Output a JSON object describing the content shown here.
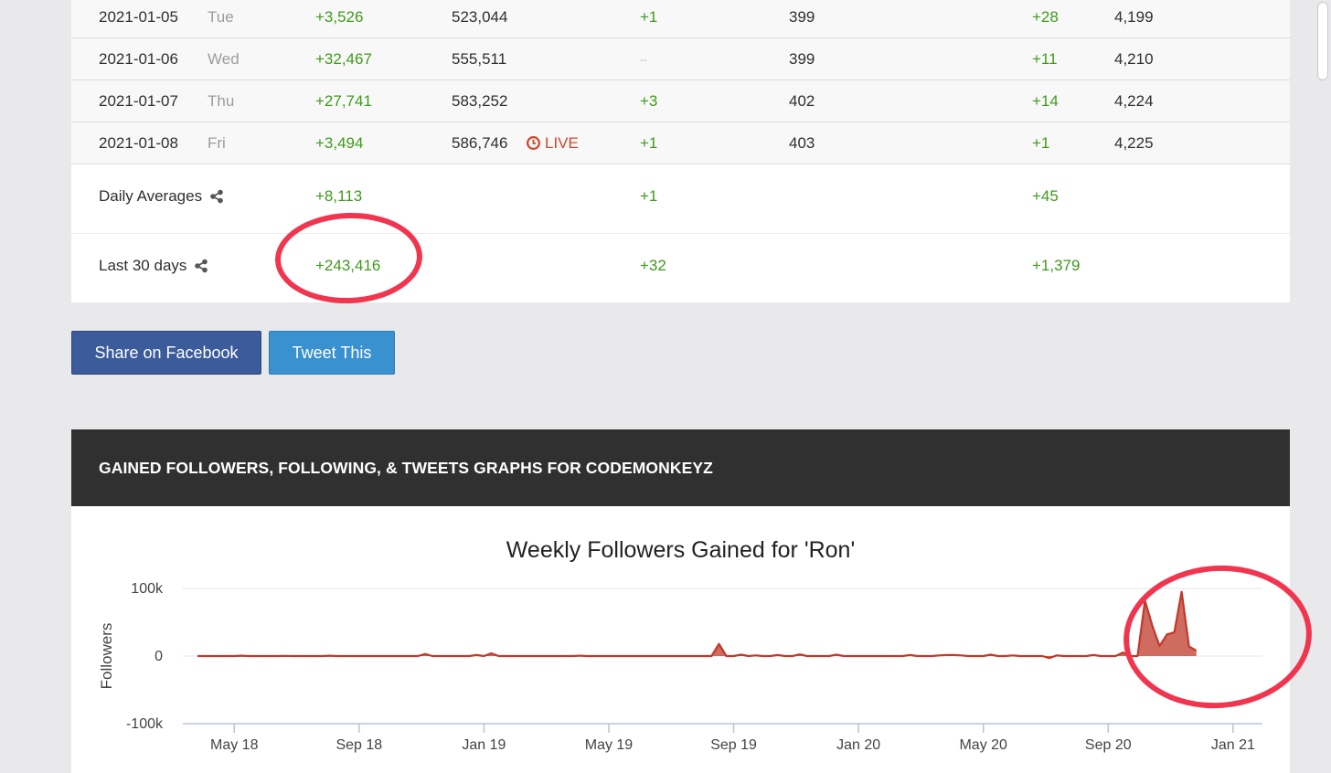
{
  "table": {
    "rows": [
      {
        "date": "2021-01-05",
        "day": "Tue",
        "followers_gain": "+3,526",
        "followers_total": "523,044",
        "live": "",
        "following_gain": "+1",
        "following_total": "399",
        "tweets_gain": "+28",
        "tweets_total": "4,199"
      },
      {
        "date": "2021-01-06",
        "day": "Wed",
        "followers_gain": "+32,467",
        "followers_total": "555,511",
        "live": "",
        "following_gain": "--",
        "following_total": "399",
        "tweets_gain": "+11",
        "tweets_total": "4,210"
      },
      {
        "date": "2021-01-07",
        "day": "Thu",
        "followers_gain": "+27,741",
        "followers_total": "583,252",
        "live": "",
        "following_gain": "+3",
        "following_total": "402",
        "tweets_gain": "+14",
        "tweets_total": "4,224"
      },
      {
        "date": "2021-01-08",
        "day": "Fri",
        "followers_gain": "+3,494",
        "followers_total": "586,746",
        "live": "LIVE",
        "following_gain": "+1",
        "following_total": "403",
        "tweets_gain": "+1",
        "tweets_total": "4,225"
      }
    ],
    "daily_averages": {
      "label": "Daily Averages",
      "followers": "+8,113",
      "following": "+1",
      "tweets": "+45"
    },
    "last_30_days": {
      "label": "Last 30 days",
      "followers": "+243,416",
      "following": "+32",
      "tweets": "+1,379"
    }
  },
  "buttons": {
    "facebook": "Share on Facebook",
    "tweet": "Tweet This"
  },
  "graph_section": {
    "header": "GAINED FOLLOWERS, FOLLOWING, & TWEETS GRAPHS FOR CODEMONKEYZ"
  },
  "colors": {
    "positive": "#3f9a1b",
    "live": "#d2452b",
    "series": "#c0392b",
    "annotation": "#f2354f",
    "facebook": "#3b5b9a",
    "twitter": "#3a91cf"
  },
  "chart_data": {
    "type": "area",
    "title": "Weekly Followers Gained for 'Ron'",
    "ylabel": "Followers",
    "xlabel": "",
    "ylim": [
      -100000,
      100000
    ],
    "yticks": [
      100000,
      0,
      -100000
    ],
    "ytick_labels": [
      "100k",
      "0",
      "-100k"
    ],
    "x_tick_labels": [
      "May 18",
      "Sep 18",
      "Jan 19",
      "May 19",
      "Sep 19",
      "Jan 20",
      "May 20",
      "Sep 20",
      "Jan 21"
    ],
    "x_tick_weeks": [
      5,
      22,
      39,
      56,
      73,
      90,
      107,
      124,
      141
    ],
    "x_range": [
      -2,
      145
    ],
    "grid": true,
    "legend": "none",
    "series": [
      {
        "values": [
          0,
          0,
          0,
          0,
          0,
          0,
          500,
          0,
          0,
          0,
          0,
          0,
          300,
          0,
          0,
          0,
          0,
          0,
          500,
          0,
          0,
          0,
          0,
          0,
          0,
          0,
          0,
          0,
          0,
          0,
          0,
          3000,
          0,
          0,
          0,
          0,
          0,
          0,
          1500,
          0,
          4000,
          0,
          0,
          0,
          0,
          0,
          0,
          0,
          0,
          0,
          0,
          0,
          500,
          0,
          0,
          0,
          0,
          0,
          0,
          0,
          0,
          0,
          0,
          0,
          0,
          0,
          0,
          0,
          0,
          0,
          0,
          18000,
          0,
          0,
          2000,
          0,
          1000,
          0,
          0,
          1500,
          0,
          0,
          2500,
          0,
          0,
          0,
          0,
          2000,
          0,
          0,
          0,
          0,
          0,
          0,
          0,
          0,
          0,
          1500,
          0,
          0,
          0,
          1000,
          1500,
          1500,
          1000,
          0,
          0,
          0,
          2000,
          0,
          0,
          1000,
          0,
          0,
          0,
          0,
          -3000,
          1000,
          0,
          0,
          0,
          0,
          1500,
          0,
          0,
          0,
          5000,
          0,
          0,
          82000,
          45000,
          15000,
          32000,
          35000,
          95000,
          14000,
          8000
        ]
      }
    ]
  }
}
